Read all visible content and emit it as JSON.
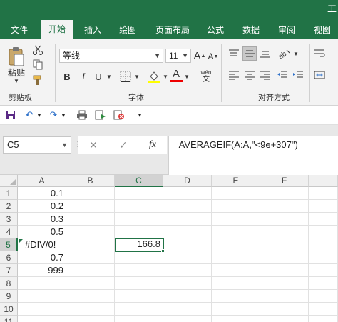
{
  "window": {
    "title_fragment": "工"
  },
  "tabs": [
    {
      "label": "文件",
      "active": false
    },
    {
      "label": "开始",
      "active": true
    },
    {
      "label": "插入",
      "active": false
    },
    {
      "label": "绘图",
      "active": false
    },
    {
      "label": "页面布局",
      "active": false
    },
    {
      "label": "公式",
      "active": false
    },
    {
      "label": "数据",
      "active": false
    },
    {
      "label": "审阅",
      "active": false
    },
    {
      "label": "视图",
      "active": false
    }
  ],
  "ribbon": {
    "clipboard": {
      "paste_label": "粘贴",
      "group_label": "剪贴板"
    },
    "font": {
      "font_name": "等线",
      "font_size": "11",
      "group_label": "字体",
      "bold": "B",
      "italic": "I",
      "underline": "U",
      "grow": "A",
      "shrink": "A",
      "font_color_letter": "A",
      "wen": "wén",
      "wen_char": "文"
    },
    "alignment": {
      "group_label": "对齐方式"
    }
  },
  "formula_bar": {
    "name_box": "C5",
    "cancel": "✕",
    "enter": "✓",
    "fx": "fx",
    "formula": "=AVERAGEIF(A:A,\"<9e+307\")"
  },
  "grid": {
    "columns": [
      "A",
      "B",
      "C",
      "D",
      "E",
      "F"
    ],
    "selected_column": "C",
    "rows": [
      "1",
      "2",
      "3",
      "4",
      "5",
      "6",
      "7",
      "8",
      "9",
      "10",
      "11"
    ],
    "selected_row": "5",
    "cells": {
      "A1": "0.1",
      "A2": "0.2",
      "A3": "0.3",
      "A4": "0.5",
      "A5": "#DIV/0!",
      "A6": "0.7",
      "A7": "999",
      "C5": "166.8"
    }
  },
  "colors": {
    "accent": "#217346"
  }
}
